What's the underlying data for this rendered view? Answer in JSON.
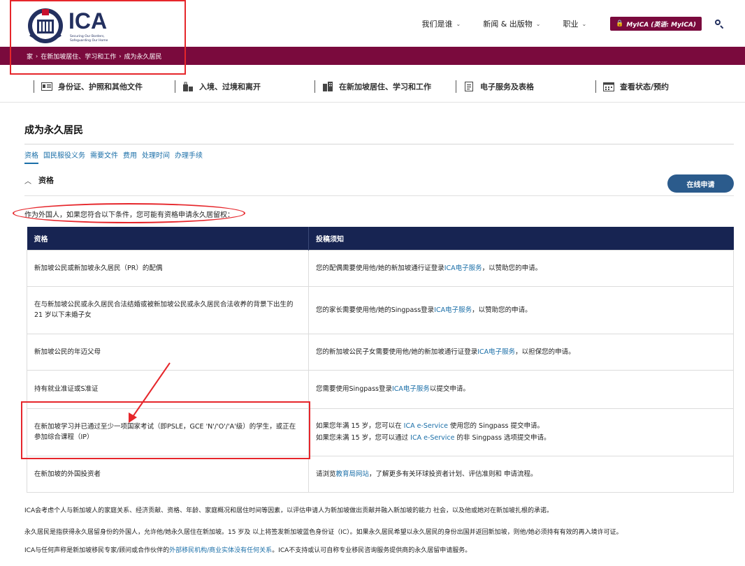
{
  "header": {
    "logo_text": "ICA",
    "logo_tagline": "Securing Our Borders, Safeguarding Our Home",
    "nav": [
      {
        "label": "我们是谁"
      },
      {
        "label": "新闻 & 出版物"
      },
      {
        "label": "职业"
      }
    ],
    "myica_label": "MyICA (英语: MyICA)"
  },
  "breadcrumb": {
    "items": [
      "家",
      "在新加坡居住、学习和工作",
      "成为永久居民"
    ]
  },
  "secondary_nav": [
    {
      "label": "身份证、护照和其他文件",
      "icon": "id-card-icon"
    },
    {
      "label": "入境、过境和离开",
      "icon": "luggage-icon"
    },
    {
      "label": "在新加坡居住、学习和工作",
      "icon": "building-icon"
    },
    {
      "label": "电子服务及表格",
      "icon": "document-icon"
    },
    {
      "label": "查看状态/预约",
      "icon": "calendar-icon"
    }
  ],
  "page": {
    "title": "成为永久居民",
    "tabs": [
      "资格",
      "国民服役义务",
      "需要文件",
      "费用",
      "处理时间",
      "办理手续"
    ],
    "accordion_title": "资格",
    "apply_button": "在线申请",
    "intro": "作为外国人，如果您符合以下条件，您可能有资格申请永久居留权："
  },
  "table": {
    "headers": [
      "资格",
      "投稿须知"
    ],
    "rows": [
      {
        "eligibility": "新加坡公民或新加坡永久居民（PR）的配偶",
        "notes": [
          {
            "pre": "您的配偶需要使用他/她的新加坡通行证登录",
            "link": "ICA电子服务",
            "post": "，以赞助您的申请。"
          }
        ]
      },
      {
        "eligibility": "在与新加坡公民或永久居民合法结婚或被新加坡公民或永久居民合法收养的背景下出生的 21 岁以下未婚子女",
        "notes": [
          {
            "pre": "您的家长需要使用他/她的Singpass登录",
            "link": "ICA电子服务",
            "post": "，以赞助您的申请。"
          }
        ]
      },
      {
        "eligibility": "新加坡公民的年迈父母",
        "notes": [
          {
            "pre": "您的新加坡公民子女需要使用他/她的新加坡通行证登录",
            "link": "ICA电子服务",
            "post": "，以担保您的申请。"
          }
        ]
      },
      {
        "eligibility": "持有就业准证或S准证",
        "notes": [
          {
            "pre": "您需要使用Singpass登录",
            "link": "ICA电子服务",
            "post": "以提交申请。"
          }
        ]
      },
      {
        "eligibility": "在新加坡学习并已通过至少一项国家考试（即PSLE，GCE 'N'/'O'/'A'级）的学生，或正在参加综合课程（IP）",
        "notes": [
          {
            "pre": "如果您年满 15 岁，您可以在 ",
            "link": "ICA e-Service",
            "post": " 使用您的 Singpass 提交申请。"
          },
          {
            "pre": "如果您未满 15 岁，您可以通过 ",
            "link": "ICA e-Service",
            "post": " 的非 Singpass 选项提交申请。"
          }
        ]
      },
      {
        "eligibility": "在新加坡的外国投资者",
        "notes": [
          {
            "pre": "请浏览",
            "link": "教育局网站",
            "post": "，了解更多有关环球投资者计划、评估准则和 申请流程。"
          }
        ]
      }
    ]
  },
  "footer_notes": [
    {
      "pre": "ICA会考虑个人与新加坡人的家庭关系、经济贡献、资格、年龄、家庭概况和居住时间等因素，以评估申请人为新加坡做出贡献并融入新加坡的能力 社会，以及他或她对在新加坡扎根的承诺。",
      "link": "",
      "post": ""
    },
    {
      "pre": "永久居民是指获得永久居留身份的外国人，允许他/她永久居住在新加坡。15 岁及 以上将签发新加坡蓝色身份证（IC）。如果永久居民希望以永久居民的身份出国并返回新加坡，则他/她必须持有有效的再入境许可证。",
      "link": "",
      "post": ""
    },
    {
      "pre": "ICA与任何声称是新加坡移民专家/顾问或合作伙伴的",
      "link": "外部移民机构/商业实体没有任何关系",
      "post": "。ICA不支持或认可自称专业移民咨询服务提供商的永久居留申请服务。"
    }
  ],
  "colors": {
    "brand_maroon": "#7a0a3d",
    "header_navy": "#172452",
    "link_blue": "#1b6fa8",
    "button_blue": "#2b5b8c",
    "annotation_red": "#e6262b"
  }
}
